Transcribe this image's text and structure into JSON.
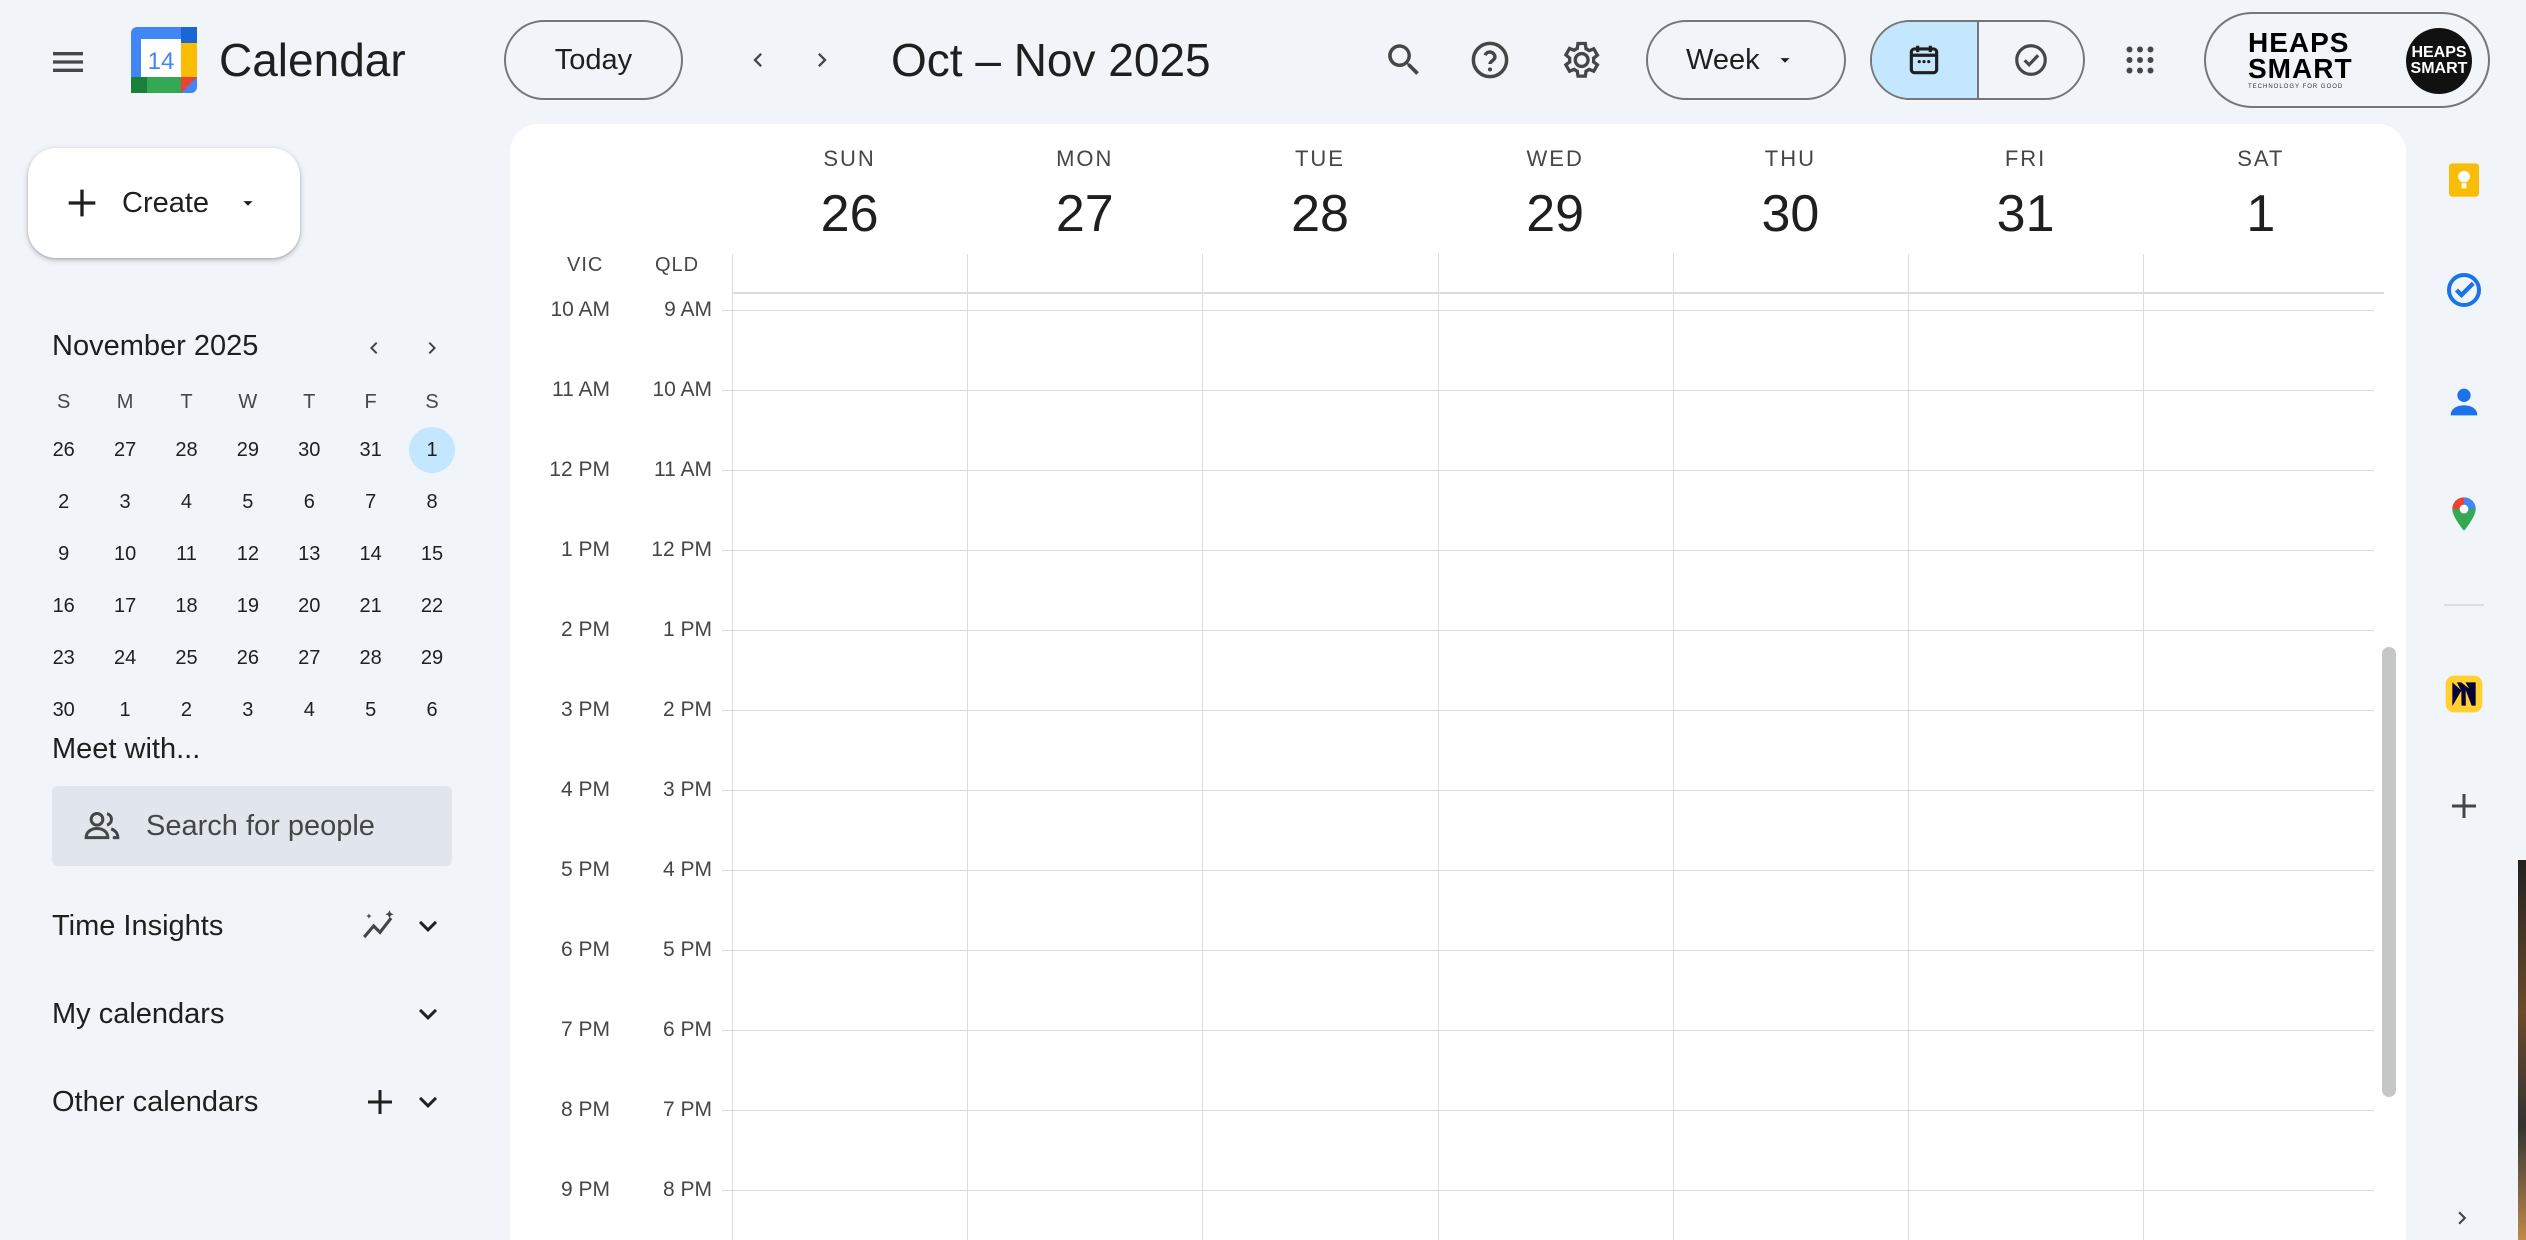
{
  "header": {
    "app_title": "Calendar",
    "logo_day": "14",
    "today_label": "Today",
    "range_title": "Oct – Nov 2025",
    "view_label": "Week",
    "account": {
      "brand_line1": "HEAPS",
      "brand_line2": "SMART",
      "brand_tagline": "TECHNOLOGY FOR GOOD",
      "avatar_text": "HEAPS SMART"
    }
  },
  "sidebar": {
    "create_label": "Create",
    "mini_calendar": {
      "title": "November 2025",
      "weekday_heads": [
        "S",
        "M",
        "T",
        "W",
        "T",
        "F",
        "S"
      ],
      "weeks": [
        [
          "26",
          "27",
          "28",
          "29",
          "30",
          "31",
          "1"
        ],
        [
          "2",
          "3",
          "4",
          "5",
          "6",
          "7",
          "8"
        ],
        [
          "9",
          "10",
          "11",
          "12",
          "13",
          "14",
          "15"
        ],
        [
          "16",
          "17",
          "18",
          "19",
          "20",
          "21",
          "22"
        ],
        [
          "23",
          "24",
          "25",
          "26",
          "27",
          "28",
          "29"
        ],
        [
          "30",
          "1",
          "2",
          "3",
          "4",
          "5",
          "6"
        ]
      ],
      "selected_day": "1"
    },
    "meet_with_title": "Meet with...",
    "people_search_placeholder": "Search for people",
    "time_insights_label": "Time Insights",
    "my_calendars_label": "My calendars",
    "other_calendars_label": "Other calendars"
  },
  "week_view": {
    "timezones": [
      "VIC",
      "QLD"
    ],
    "days": [
      {
        "dow": "SUN",
        "num": "26"
      },
      {
        "dow": "MON",
        "num": "27"
      },
      {
        "dow": "TUE",
        "num": "28"
      },
      {
        "dow": "WED",
        "num": "29"
      },
      {
        "dow": "THU",
        "num": "30"
      },
      {
        "dow": "FRI",
        "num": "31"
      },
      {
        "dow": "SAT",
        "num": "1"
      }
    ],
    "time_rows": [
      {
        "vic": "10 AM",
        "qld": "9 AM"
      },
      {
        "vic": "11 AM",
        "qld": "10 AM"
      },
      {
        "vic": "12 PM",
        "qld": "11 AM"
      },
      {
        "vic": "1 PM",
        "qld": "12 PM"
      },
      {
        "vic": "2 PM",
        "qld": "1 PM"
      },
      {
        "vic": "3 PM",
        "qld": "2 PM"
      },
      {
        "vic": "4 PM",
        "qld": "3 PM"
      },
      {
        "vic": "5 PM",
        "qld": "4 PM"
      },
      {
        "vic": "6 PM",
        "qld": "5 PM"
      },
      {
        "vic": "7 PM",
        "qld": "6 PM"
      },
      {
        "vic": "8 PM",
        "qld": "7 PM"
      },
      {
        "vic": "9 PM",
        "qld": "8 PM"
      }
    ]
  },
  "right_rail": {
    "apps": [
      "keep-icon",
      "tasks-icon",
      "contacts-icon",
      "maps-icon",
      "miro-icon",
      "add-addon-icon"
    ]
  },
  "colors": {
    "page_bg": "#f1f4f9",
    "selected_bg": "#c2e7ff",
    "grid_line": "#dadce0",
    "text_primary": "#1f1f1f",
    "text_secondary": "#444746"
  }
}
